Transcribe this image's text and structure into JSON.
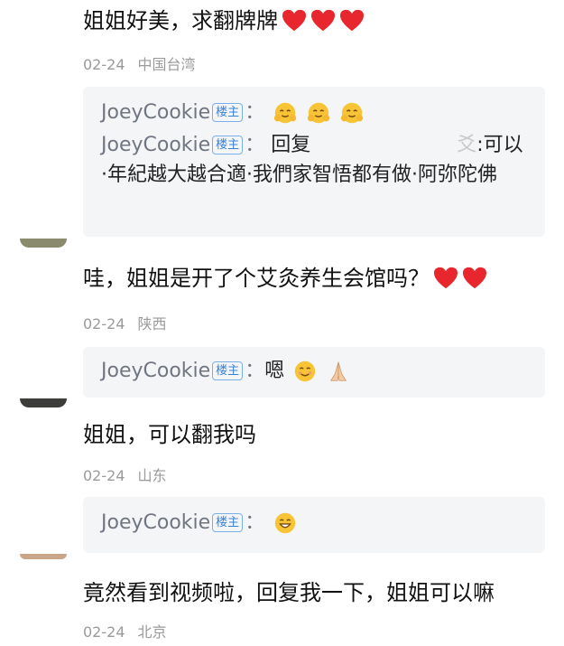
{
  "comments": [
    {
      "text": "姐姐好美，求翻牌牌",
      "hearts": 3,
      "date": "02-24",
      "location": "中国台湾",
      "replies": [
        {
          "author": "JoeyCookie",
          "badge": "楼主",
          "colon": "：",
          "text": "",
          "emoji": [
            "hug-face",
            "hug-face",
            "hug-face"
          ]
        },
        {
          "author": "JoeyCookie",
          "badge": "楼主",
          "colon": "：",
          "text_prefix": "回复",
          "text_masked_tail": "爻",
          "text": ":可以·年紀越大越合適·我們家智悟都有做·阿弥陀佛"
        }
      ]
    },
    {
      "text": "哇，姐姐是开了个艾灸养生会馆吗？",
      "hearts": 2,
      "date": "02-24",
      "location": "陕西",
      "replies": [
        {
          "author": "JoeyCookie",
          "badge": "楼主",
          "colon": "：",
          "text": "嗯",
          "emoji": [
            "smile-face",
            "praying-hands"
          ]
        }
      ]
    },
    {
      "text": "姐姐，可以翻我吗",
      "hearts": 0,
      "date": "02-24",
      "location": "山东",
      "replies": [
        {
          "author": "JoeyCookie",
          "badge": "楼主",
          "colon": "：",
          "text": "",
          "emoji": [
            "grin-face"
          ]
        }
      ]
    },
    {
      "text": "竟然看到视频啦，回复我一下，姐姐可以嘛",
      "hearts": 0,
      "date": "02-24",
      "location": "北京",
      "replies": []
    }
  ],
  "colors": {
    "heart": "#e8262e",
    "badge": "#3a82d6",
    "reply_bg": "#f4f5f7",
    "meta": "#9a9a9a"
  }
}
